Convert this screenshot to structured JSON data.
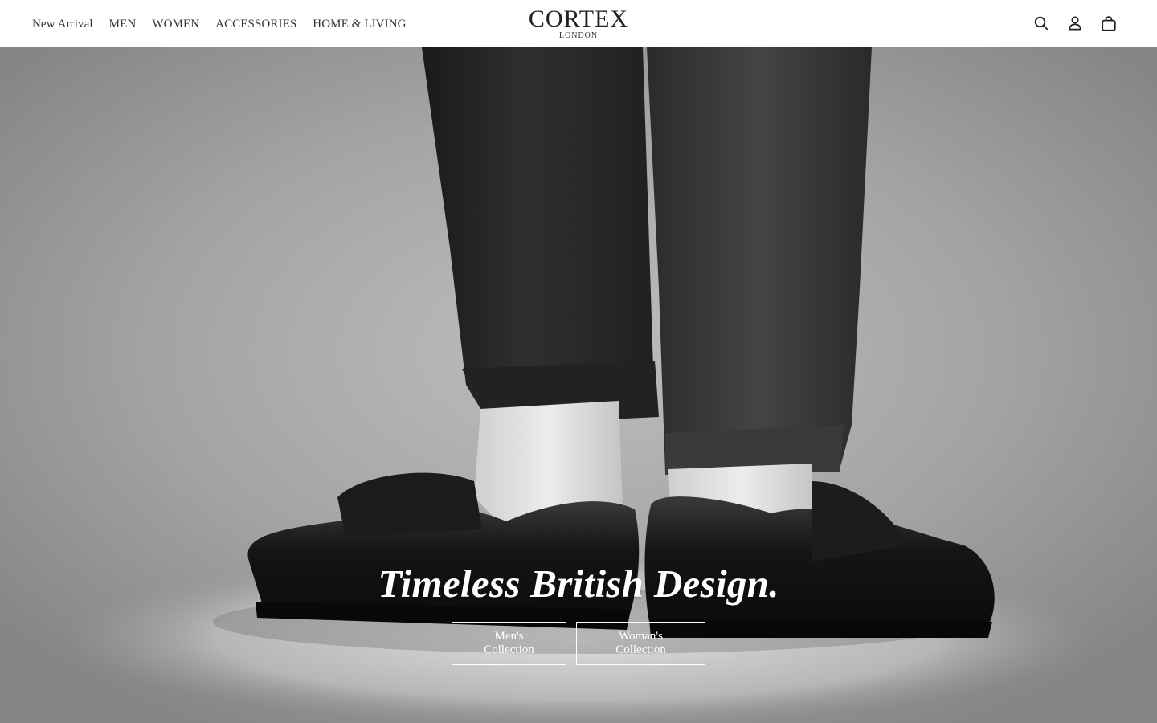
{
  "header": {
    "nav": [
      {
        "label": "New Arrival"
      },
      {
        "label": "MEN"
      },
      {
        "label": "WOMEN"
      },
      {
        "label": "ACCESSORIES"
      },
      {
        "label": "HOME & LIVING"
      }
    ],
    "logo": {
      "word": "CORTEX",
      "sub": "LONDON"
    },
    "icons": [
      "search-icon",
      "account-icon",
      "bag-icon"
    ]
  },
  "hero": {
    "title": "Timeless British Design.",
    "buttons": {
      "men": "Men's Collection",
      "women": "Woman's Collection"
    },
    "image": "black-and-white photo of legs in dark denim trousers, white ribbed socks and black leather penny loafers on a grey studio background"
  },
  "colors": {
    "header_bg": "#ffffff",
    "hero_bg": "#8a8a8a",
    "text_dark": "#222222",
    "hero_text": "#ffffff"
  }
}
